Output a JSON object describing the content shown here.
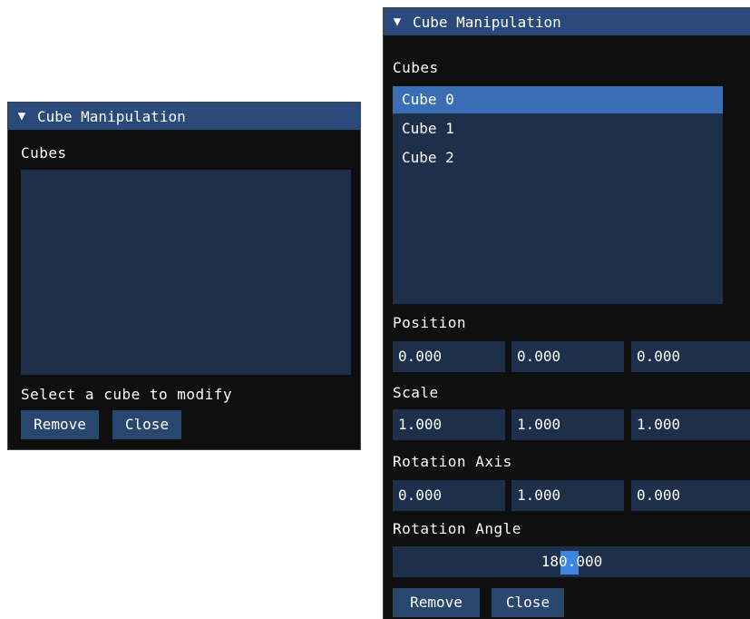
{
  "window_left": {
    "title": "Cube Manipulation",
    "collapse_icon": "triangle-down-icon",
    "cubes_label": "Cubes",
    "cubes_list": [],
    "hint": "Select a cube to modify",
    "remove_label": "Remove",
    "close_label": "Close"
  },
  "window_right": {
    "title": "Cube Manipulation",
    "collapse_icon": "triangle-down-icon",
    "cubes_label": "Cubes",
    "cubes_list": [
      "Cube 0",
      "Cube 1",
      "Cube 2"
    ],
    "selected_index": 0,
    "position_label": "Position",
    "position": [
      "0.000",
      "0.000",
      "0.000"
    ],
    "scale_label": "Scale",
    "scale": [
      "1.000",
      "1.000",
      "1.000"
    ],
    "rotation_axis_label": "Rotation Axis",
    "rotation_axis": [
      "0.000",
      "1.000",
      "0.000"
    ],
    "rotation_angle_label": "Rotation Angle",
    "rotation_angle": "180.000",
    "remove_label": "Remove",
    "close_label": "Close"
  },
  "colors": {
    "title_bg": "#294a7a",
    "window_bg": "#0f0f0f",
    "field_bg": "#1d2f4a",
    "selected_bg": "#3a6fb5",
    "button_bg": "#29466f",
    "slider_grab": "#3d85e0"
  }
}
